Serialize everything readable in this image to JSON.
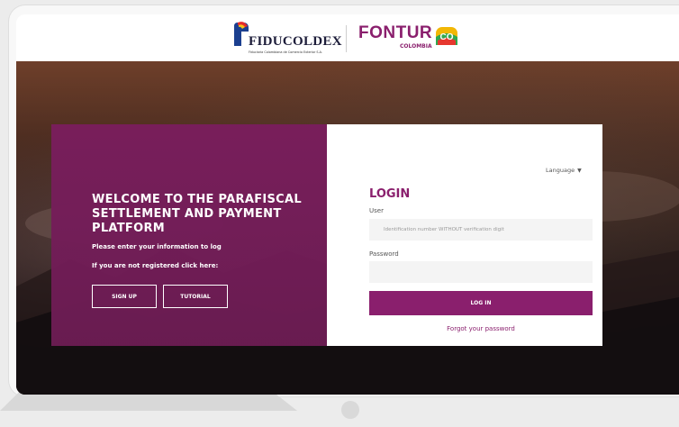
{
  "logos": {
    "fiducoldex_name": "FIDUCOLDEX",
    "fiducoldex_tagline": "Fiduciaria Colombiana de Comercio Exterior S.A.",
    "fontur_name": "FONTUR",
    "fontur_sub": "COLOMBIA",
    "fontur_co": "CO"
  },
  "welcome": {
    "title": "WELCOME TO THE PARAFISCAL SETTLEMENT AND PAYMENT PLATFORM",
    "subtitle": "Please enter your information to log",
    "register_prompt": "If you are not registered click here:",
    "signup_label": "SIGN UP",
    "tutorial_label": "TUTORIAL"
  },
  "login": {
    "language_label": "Language",
    "title": "LOGIN",
    "user_label": "User",
    "user_placeholder": "Identification number WITHOUT verification digit",
    "password_label": "Password",
    "password_placeholder": "",
    "login_button": "LOG IN",
    "forgot_link": "Forgot your password"
  },
  "colors": {
    "brand": "#8a1f6d",
    "panel": "#7a1d5d",
    "input_bg": "#f4f4f4"
  },
  "icons": [
    "fiducoldex-logo-icon",
    "fontur-co-icon",
    "chevron-down-icon",
    "home-button-icon"
  ]
}
